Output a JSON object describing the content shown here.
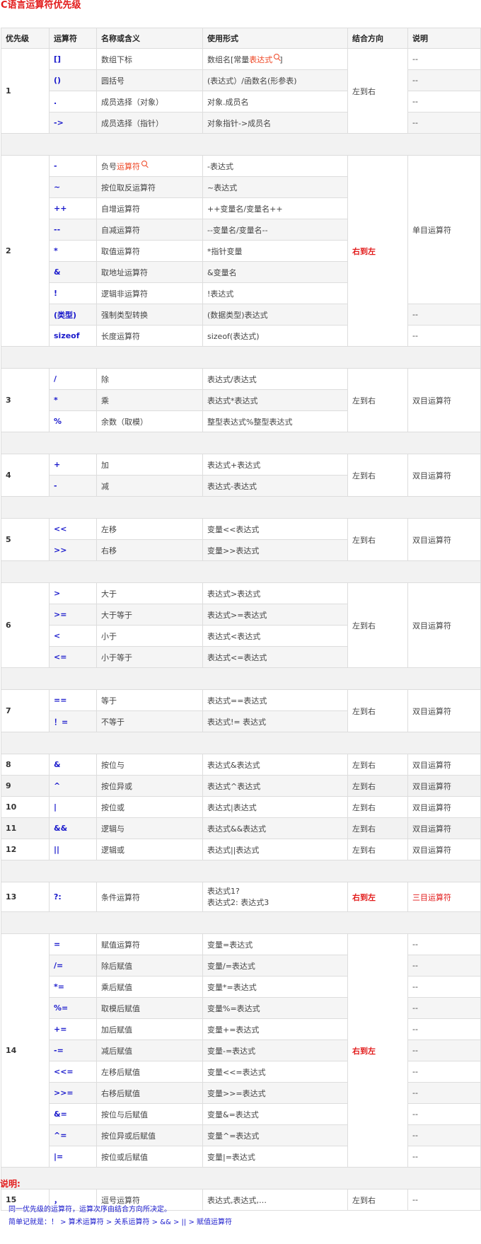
{
  "title": "C语言运算符优先级",
  "headers": [
    "优先级",
    "运算符",
    "名称或含义",
    "使用形式",
    "结合方向",
    "说明"
  ],
  "groups": [
    {
      "level": "1",
      "direction": "左到右",
      "direction_red": false,
      "rows": [
        {
          "op": "[]",
          "name": "数组下标",
          "usage": "数组名[常量",
          "usage_link": "表达式",
          "usage_after": "]",
          "note": "--"
        },
        {
          "op": "()",
          "name": "圆括号",
          "usage": "(表达式）/函数名(形参表)",
          "note": "--"
        },
        {
          "op": ".",
          "name": "成员选择（对象）",
          "usage": "对象.成员名",
          "note": "--"
        },
        {
          "op": "->",
          "name": "成员选择（指针）",
          "usage": "对象指针->成员名",
          "note": "--"
        }
      ]
    },
    {
      "level": "2",
      "direction": "右到左",
      "direction_red": true,
      "shared_note": "单目运算符",
      "shared_note_rows": 7,
      "rows": [
        {
          "op": "-",
          "name": "负号",
          "name_link": "运算符",
          "usage": "-表达式"
        },
        {
          "op": "~",
          "name": "按位取反运算符",
          "usage": "~表达式"
        },
        {
          "op": "++",
          "name": "自增运算符",
          "usage": "++变量名/变量名++"
        },
        {
          "op": "--",
          "name": "自减运算符",
          "usage": "--变量名/变量名--"
        },
        {
          "op": "*",
          "name": "取值运算符",
          "usage": "*指针变量"
        },
        {
          "op": "&",
          "name": "取地址运算符",
          "usage": "&变量名"
        },
        {
          "op": "!",
          "name": "逻辑非运算符",
          "usage": "!表达式"
        },
        {
          "op": "(类型)",
          "name": "强制类型转换",
          "usage": "(数据类型)表达式",
          "note": "--"
        },
        {
          "op": "sizeof",
          "name": "长度运算符",
          "usage": "sizeof(表达式)",
          "note": "--"
        }
      ]
    },
    {
      "level": "3",
      "direction": "左到右",
      "direction_red": false,
      "shared_note": "双目运算符",
      "shared_note_rows": 3,
      "rows": [
        {
          "op": "/",
          "name": "除",
          "usage": "表达式/表达式"
        },
        {
          "op": "*",
          "name": "乘",
          "usage": "表达式*表达式"
        },
        {
          "op": "%",
          "name": "余数（取模）",
          "usage": "整型表达式%整型表达式"
        }
      ]
    },
    {
      "level": "4",
      "direction": "左到右",
      "direction_red": false,
      "shared_note": "双目运算符",
      "shared_note_rows": 2,
      "rows": [
        {
          "op": "+",
          "name": "加",
          "usage": "表达式+表达式"
        },
        {
          "op": "-",
          "name": "减",
          "usage": "表达式-表达式"
        }
      ]
    },
    {
      "level": "5",
      "direction": "左到右",
      "direction_red": false,
      "shared_note": "双目运算符",
      "shared_note_rows": 2,
      "rows": [
        {
          "op": "<<",
          "name": "左移",
          "usage": "变量<<表达式"
        },
        {
          "op": ">>",
          "name": "右移",
          "usage": "变量>>表达式"
        }
      ]
    },
    {
      "level": "6",
      "direction": "左到右",
      "direction_red": false,
      "shared_note": "双目运算符",
      "shared_note_rows": 4,
      "rows": [
        {
          "op": ">",
          "name": "大于",
          "usage": "表达式>表达式"
        },
        {
          "op": ">=",
          "name": "大于等于",
          "usage": "表达式>=表达式"
        },
        {
          "op": "<",
          "name": "小于",
          "usage": "表达式<表达式"
        },
        {
          "op": "<=",
          "name": "小于等于",
          "usage": "表达式<=表达式"
        }
      ]
    },
    {
      "level": "7",
      "direction": "左到右",
      "direction_red": false,
      "shared_note": "双目运算符",
      "shared_note_rows": 2,
      "no_sep_after": true,
      "rows": [
        {
          "op": "==",
          "name": "等于",
          "usage": "表达式==表达式"
        },
        {
          "op": "！=",
          "name": "不等于",
          "usage": "表达式!= 表达式"
        }
      ]
    },
    {
      "level": "8",
      "direction": "左到右",
      "direction_red": false,
      "shared_note": "双目运算符",
      "shared_note_rows": 1,
      "compact": true,
      "rows": [
        {
          "op": "&",
          "name": "按位与",
          "usage": "表达式&表达式"
        }
      ]
    },
    {
      "level": "9",
      "direction": "左到右",
      "direction_red": false,
      "shared_note": "双目运算符",
      "shared_note_rows": 1,
      "compact": true,
      "rows": [
        {
          "op": "^",
          "name": "按位异或",
          "usage": "表达式^表达式"
        }
      ]
    },
    {
      "level": "10",
      "direction": "左到右",
      "direction_red": false,
      "shared_note": "双目运算符",
      "shared_note_rows": 1,
      "compact": true,
      "rows": [
        {
          "op": "|",
          "name": "按位或",
          "usage": "表达式|表达式"
        }
      ]
    },
    {
      "level": "11",
      "direction": "左到右",
      "direction_red": false,
      "shared_note": "双目运算符",
      "shared_note_rows": 1,
      "compact": true,
      "rows": [
        {
          "op": "&&",
          "name": "逻辑与",
          "usage": "表达式&&表达式"
        }
      ]
    },
    {
      "level": "12",
      "direction": "左到右",
      "direction_red": false,
      "shared_note": "双目运算符",
      "shared_note_rows": 1,
      "compact": true,
      "rows": [
        {
          "op": "||",
          "name": "逻辑或",
          "usage": "表达式||表达式"
        }
      ]
    },
    {
      "level": "13",
      "direction": "右到左",
      "direction_red": true,
      "shared_note": "三目运算符",
      "shared_note_red": true,
      "shared_note_rows": 1,
      "tall": true,
      "rows": [
        {
          "op": "?:",
          "name": "条件运算符",
          "usage": "表达式1?",
          "usage_line2": "表达式2: 表达式3"
        }
      ]
    },
    {
      "level": "14",
      "direction": "右到左",
      "direction_red": true,
      "rows": [
        {
          "op": "=",
          "name": "赋值运算符",
          "usage": "变量=表达式",
          "note": "--"
        },
        {
          "op": "/=",
          "name": "除后赋值",
          "usage": "变量/=表达式",
          "note": "--"
        },
        {
          "op": "*=",
          "name": "乘后赋值",
          "usage": "变量*=表达式",
          "note": "--"
        },
        {
          "op": "%=",
          "name": "取模后赋值",
          "usage": "变量%=表达式",
          "note": "--"
        },
        {
          "op": "+=",
          "name": "加后赋值",
          "usage": "变量+=表达式",
          "note": "--"
        },
        {
          "op": "-=",
          "name": "减后赋值",
          "usage": "变量-=表达式",
          "note": "--"
        },
        {
          "op": "<<=",
          "name": "左移后赋值",
          "usage": "变量<<=表达式",
          "note": "--"
        },
        {
          "op": ">>=",
          "name": "右移后赋值",
          "usage": "变量>>=表达式",
          "note": "--"
        },
        {
          "op": "&=",
          "name": "按位与后赋值",
          "usage": "变量&=表达式",
          "note": "--"
        },
        {
          "op": "^=",
          "name": "按位异或后赋值",
          "usage": "变量^=表达式",
          "note": "--"
        },
        {
          "op": "|=",
          "name": "按位或后赋值",
          "usage": "变量|=表达式",
          "note": "--"
        }
      ]
    },
    {
      "level": "15",
      "direction": "左到右",
      "direction_red": false,
      "last": true,
      "rows": [
        {
          "op": "，",
          "name": "逗号运算符",
          "usage": "表达式,表达式,…",
          "note": "--"
        }
      ]
    }
  ],
  "notes": {
    "title": "说明:",
    "lines": [
      "同一优先级的运算符，运算次序由结合方向所决定。",
      "简单记就是：！ > 算术运算符 > 关系运算符 > && > || > 赋值运算符"
    ]
  }
}
